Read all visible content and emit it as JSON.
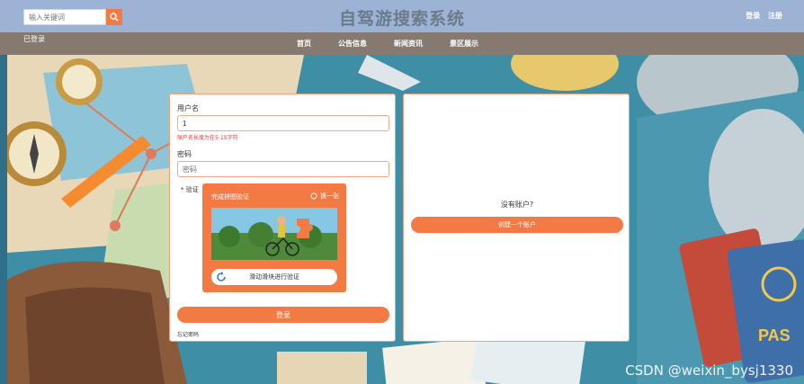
{
  "header": {
    "search_placeholder": "输入关键词",
    "title": "自驾游搜索系统",
    "auth": {
      "login": "登录",
      "register": "注册"
    }
  },
  "nav": {
    "note": "已登录",
    "items": [
      "首页",
      "公告信息",
      "新闻资讯",
      "景区展示"
    ]
  },
  "login": {
    "username_label": "用户名",
    "username_value": "1",
    "username_error": "账户名长度为在5-15字符",
    "password_label": "密码",
    "password_placeholder": "密码",
    "captcha_label": "* 验证",
    "captcha_title": "完成拼图验证",
    "captcha_refresh": "换一张",
    "captcha_slider_text": "滑动滑块进行验证",
    "submit_label": "登录",
    "forgot_label": "忘记密码"
  },
  "register": {
    "prompt": "没有账户?",
    "button_label": "创建一个账户"
  },
  "watermark": "CSDN @weixin_bysj1330",
  "colors": {
    "accent": "#f47a44",
    "header_bg": "#9db3d6",
    "nav_bg": "#867a70",
    "error": "#e4393c"
  }
}
